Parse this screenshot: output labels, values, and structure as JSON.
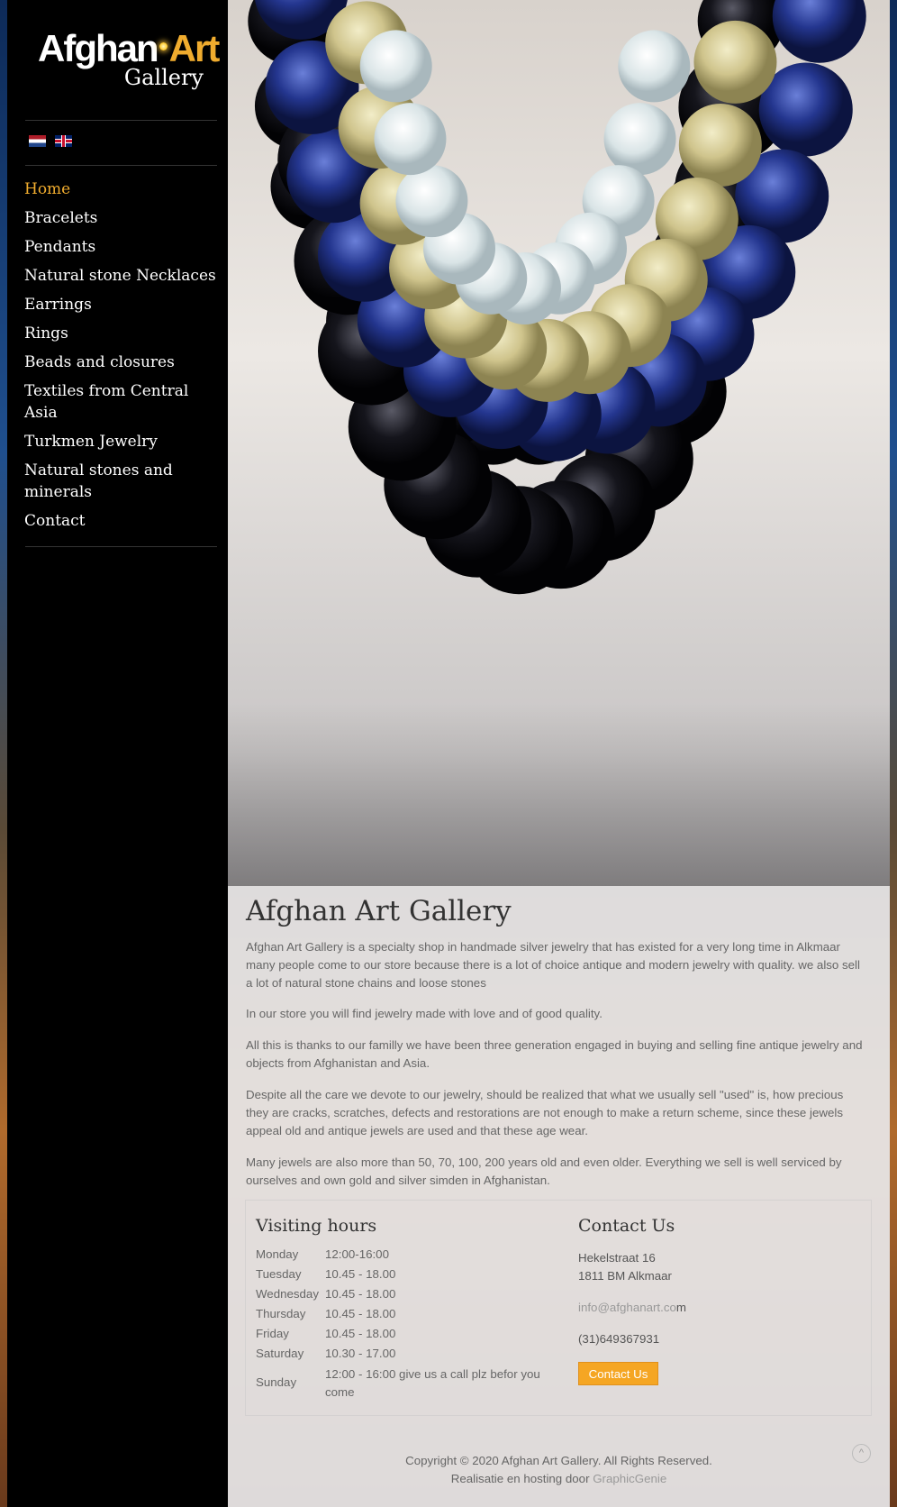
{
  "logo": {
    "line1_a": "Afghan",
    "line1_b": "Art",
    "line2": "Gallery"
  },
  "languages": [
    {
      "name": "nl-flag-icon"
    },
    {
      "name": "uk-flag-icon"
    }
  ],
  "nav": {
    "items": [
      {
        "label": "Home",
        "active": true
      },
      {
        "label": "Bracelets"
      },
      {
        "label": "Pendants"
      },
      {
        "label": "Natural stone Necklaces"
      },
      {
        "label": "Earrings"
      },
      {
        "label": "Rings"
      },
      {
        "label": "Beads and closures"
      },
      {
        "label": "Textiles from Central Asia"
      },
      {
        "label": "Turkmen Jewelry"
      },
      {
        "label": "Natural stones and minerals"
      },
      {
        "label": "Contact"
      }
    ]
  },
  "main": {
    "title": "Afghan Art Gallery",
    "paragraphs": [
      " Afghan Art Gallery is a specialty shop in handmade silver jewelry that has existed for a very long time in Alkmaar many people come to our store because there is a lot of choice antique and modern jewelry with quality. we also sell a lot of natural stone chains and loose stones",
      "In our store you will find jewelry made with love and of good quality.",
      "All this is thanks to our familly we have  been three generation engaged in buying and  selling fine antique jewelry and objects from Afghanistan and Asia.",
      "Despite all the care we devote to our jewelry, should be realized that what we usually sell \"used\" is, how precious they are cracks, scratches, defects and restorations are not enough to make a return scheme, since these jewels appeal old and antique jewels are used and that these age wear.",
      "Many jewels are also more than 50, 70, 100, 200 years old and even older. Everything we sell is well serviced by ourselves and own gold and silver simden in Afghanistan."
    ]
  },
  "visiting": {
    "title": "Visiting hours",
    "rows": [
      {
        "day": "Monday",
        "hours": "12:00-16:00"
      },
      {
        "day": "Tuesday",
        "hours": "10.45 - 18.00"
      },
      {
        "day": "Wednesday",
        "hours": "10.45 - 18.00"
      },
      {
        "day": "Thursday",
        "hours": "10.45 - 18.00"
      },
      {
        "day": "Friday",
        "hours": "10.45 - 18.00"
      },
      {
        "day": "Saturday",
        "hours": "10.30 - 17.00"
      },
      {
        "day": "Sunday",
        "hours": "12:00 - 16:00 give us a call plz  befor you come"
      }
    ]
  },
  "contact": {
    "title": "Contact Us",
    "street": "Hekelstraat 16",
    "city": "1811 BM Alkmaar",
    "email_link": "info@afghanart.co",
    "email_tail": "m",
    "phone": "(31)649367931",
    "button": "Contact Us"
  },
  "footer": {
    "copyright": "Copyright © 2020 Afghan Art Gallery. All Rights Reserved.",
    "hosting_prefix": "Realisatie en hosting door ",
    "hosting_link": "GraphicGenie"
  },
  "colors": {
    "accent": "#f0ac2e",
    "button": "#f5a623",
    "sidebar": "#000000"
  }
}
